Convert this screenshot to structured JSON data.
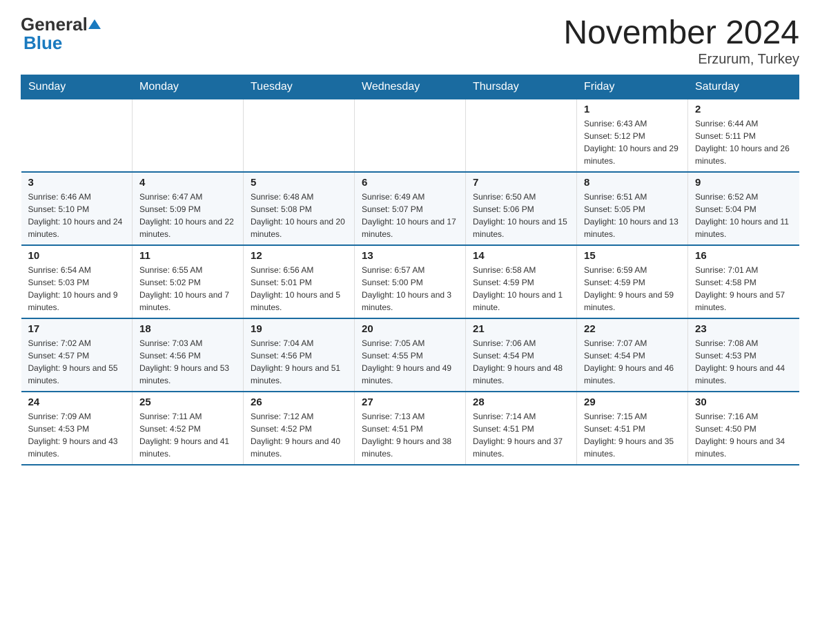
{
  "header": {
    "logo_general": "General",
    "logo_blue": "Blue",
    "month_title": "November 2024",
    "location": "Erzurum, Turkey"
  },
  "days_header": [
    "Sunday",
    "Monday",
    "Tuesday",
    "Wednesday",
    "Thursday",
    "Friday",
    "Saturday"
  ],
  "weeks": [
    [
      {
        "day": "",
        "info": ""
      },
      {
        "day": "",
        "info": ""
      },
      {
        "day": "",
        "info": ""
      },
      {
        "day": "",
        "info": ""
      },
      {
        "day": "",
        "info": ""
      },
      {
        "day": "1",
        "info": "Sunrise: 6:43 AM\nSunset: 5:12 PM\nDaylight: 10 hours and 29 minutes."
      },
      {
        "day": "2",
        "info": "Sunrise: 6:44 AM\nSunset: 5:11 PM\nDaylight: 10 hours and 26 minutes."
      }
    ],
    [
      {
        "day": "3",
        "info": "Sunrise: 6:46 AM\nSunset: 5:10 PM\nDaylight: 10 hours and 24 minutes."
      },
      {
        "day": "4",
        "info": "Sunrise: 6:47 AM\nSunset: 5:09 PM\nDaylight: 10 hours and 22 minutes."
      },
      {
        "day": "5",
        "info": "Sunrise: 6:48 AM\nSunset: 5:08 PM\nDaylight: 10 hours and 20 minutes."
      },
      {
        "day": "6",
        "info": "Sunrise: 6:49 AM\nSunset: 5:07 PM\nDaylight: 10 hours and 17 minutes."
      },
      {
        "day": "7",
        "info": "Sunrise: 6:50 AM\nSunset: 5:06 PM\nDaylight: 10 hours and 15 minutes."
      },
      {
        "day": "8",
        "info": "Sunrise: 6:51 AM\nSunset: 5:05 PM\nDaylight: 10 hours and 13 minutes."
      },
      {
        "day": "9",
        "info": "Sunrise: 6:52 AM\nSunset: 5:04 PM\nDaylight: 10 hours and 11 minutes."
      }
    ],
    [
      {
        "day": "10",
        "info": "Sunrise: 6:54 AM\nSunset: 5:03 PM\nDaylight: 10 hours and 9 minutes."
      },
      {
        "day": "11",
        "info": "Sunrise: 6:55 AM\nSunset: 5:02 PM\nDaylight: 10 hours and 7 minutes."
      },
      {
        "day": "12",
        "info": "Sunrise: 6:56 AM\nSunset: 5:01 PM\nDaylight: 10 hours and 5 minutes."
      },
      {
        "day": "13",
        "info": "Sunrise: 6:57 AM\nSunset: 5:00 PM\nDaylight: 10 hours and 3 minutes."
      },
      {
        "day": "14",
        "info": "Sunrise: 6:58 AM\nSunset: 4:59 PM\nDaylight: 10 hours and 1 minute."
      },
      {
        "day": "15",
        "info": "Sunrise: 6:59 AM\nSunset: 4:59 PM\nDaylight: 9 hours and 59 minutes."
      },
      {
        "day": "16",
        "info": "Sunrise: 7:01 AM\nSunset: 4:58 PM\nDaylight: 9 hours and 57 minutes."
      }
    ],
    [
      {
        "day": "17",
        "info": "Sunrise: 7:02 AM\nSunset: 4:57 PM\nDaylight: 9 hours and 55 minutes."
      },
      {
        "day": "18",
        "info": "Sunrise: 7:03 AM\nSunset: 4:56 PM\nDaylight: 9 hours and 53 minutes."
      },
      {
        "day": "19",
        "info": "Sunrise: 7:04 AM\nSunset: 4:56 PM\nDaylight: 9 hours and 51 minutes."
      },
      {
        "day": "20",
        "info": "Sunrise: 7:05 AM\nSunset: 4:55 PM\nDaylight: 9 hours and 49 minutes."
      },
      {
        "day": "21",
        "info": "Sunrise: 7:06 AM\nSunset: 4:54 PM\nDaylight: 9 hours and 48 minutes."
      },
      {
        "day": "22",
        "info": "Sunrise: 7:07 AM\nSunset: 4:54 PM\nDaylight: 9 hours and 46 minutes."
      },
      {
        "day": "23",
        "info": "Sunrise: 7:08 AM\nSunset: 4:53 PM\nDaylight: 9 hours and 44 minutes."
      }
    ],
    [
      {
        "day": "24",
        "info": "Sunrise: 7:09 AM\nSunset: 4:53 PM\nDaylight: 9 hours and 43 minutes."
      },
      {
        "day": "25",
        "info": "Sunrise: 7:11 AM\nSunset: 4:52 PM\nDaylight: 9 hours and 41 minutes."
      },
      {
        "day": "26",
        "info": "Sunrise: 7:12 AM\nSunset: 4:52 PM\nDaylight: 9 hours and 40 minutes."
      },
      {
        "day": "27",
        "info": "Sunrise: 7:13 AM\nSunset: 4:51 PM\nDaylight: 9 hours and 38 minutes."
      },
      {
        "day": "28",
        "info": "Sunrise: 7:14 AM\nSunset: 4:51 PM\nDaylight: 9 hours and 37 minutes."
      },
      {
        "day": "29",
        "info": "Sunrise: 7:15 AM\nSunset: 4:51 PM\nDaylight: 9 hours and 35 minutes."
      },
      {
        "day": "30",
        "info": "Sunrise: 7:16 AM\nSunset: 4:50 PM\nDaylight: 9 hours and 34 minutes."
      }
    ]
  ]
}
